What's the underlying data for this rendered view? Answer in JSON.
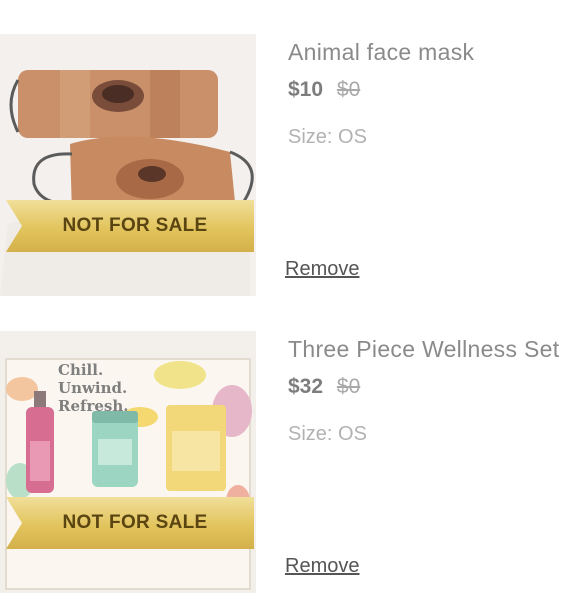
{
  "cart": {
    "items": [
      {
        "title": "Animal face mask",
        "price": "$10",
        "original_price": "$0",
        "size": "Size: OS",
        "badge": "NOT FOR SALE",
        "remove_label": "Remove",
        "image_icon": "face-mask-image"
      },
      {
        "title": "Three Piece Wellness Set",
        "price": "$32",
        "original_price": "$0",
        "size": "Size: OS",
        "badge": "NOT FOR SALE",
        "remove_label": "Remove",
        "image_icon": "wellness-set-image",
        "box_text": "Chill. Unwind. Refresh."
      }
    ]
  }
}
